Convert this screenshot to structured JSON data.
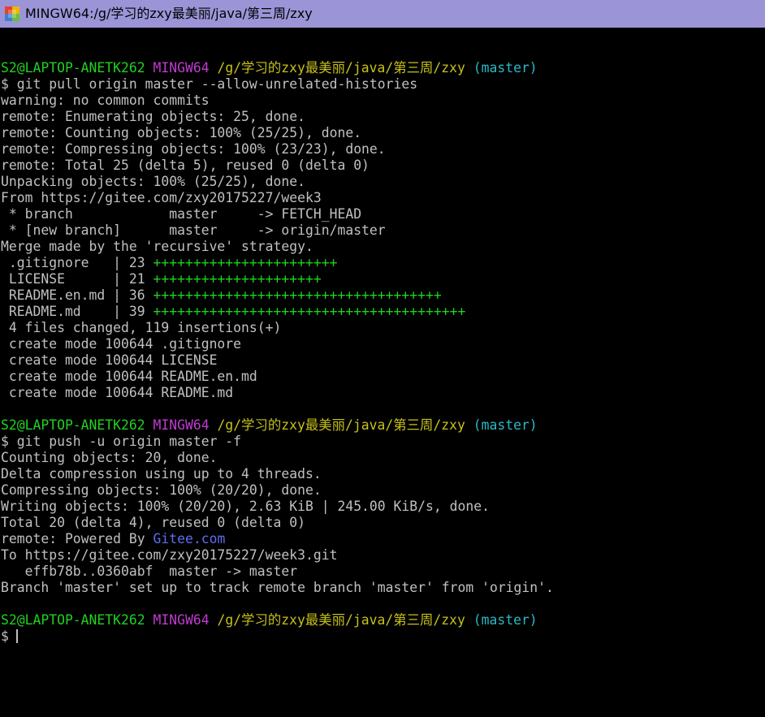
{
  "window": {
    "title": "MINGW64:/g/学习的zxy最美丽/java/第三周/zxy",
    "icon": "git-bash-icon"
  },
  "colors": {
    "default": "#c0c0c0",
    "green": "#1fd31f",
    "magenta": "#c03bd0",
    "yellow": "#c6c01b",
    "cyan": "#2bb9c6",
    "blue": "#5f6cf0",
    "titlebar": "#9b95d8"
  },
  "lines": [
    [],
    [
      {
        "t": "S2@LAPTOP-ANETK262 ",
        "c": "green"
      },
      {
        "t": "MINGW64 ",
        "c": "magenta"
      },
      {
        "t": "/g/学习的zxy最美丽/java/第三周/zxy ",
        "c": "yellow"
      },
      {
        "t": "(master)",
        "c": "cyan"
      }
    ],
    [
      {
        "t": "$ git pull origin master --allow-unrelated-histories"
      }
    ],
    [
      {
        "t": "warning: no common commits"
      }
    ],
    [
      {
        "t": "remote: Enumerating objects: 25, done."
      }
    ],
    [
      {
        "t": "remote: Counting objects: 100% (25/25), done."
      }
    ],
    [
      {
        "t": "remote: Compressing objects: 100% (23/23), done."
      }
    ],
    [
      {
        "t": "remote: Total 25 (delta 5), reused 0 (delta 0)"
      }
    ],
    [
      {
        "t": "Unpacking objects: 100% (25/25), done."
      }
    ],
    [
      {
        "t": "From https://gitee.com/zxy20175227/week3"
      }
    ],
    [
      {
        "t": " * branch            master     -> FETCH_HEAD"
      }
    ],
    [
      {
        "t": " * [new branch]      master     -> origin/master"
      }
    ],
    [
      {
        "t": "Merge made by the 'recursive' strategy."
      }
    ],
    [
      {
        "t": " .gitignore   | 23 "
      },
      {
        "t": "+++++++++++++++++++++++",
        "c": "green"
      }
    ],
    [
      {
        "t": " LICENSE      | 21 "
      },
      {
        "t": "+++++++++++++++++++++",
        "c": "green"
      }
    ],
    [
      {
        "t": " README.en.md | 36 "
      },
      {
        "t": "++++++++++++++++++++++++++++++++++++",
        "c": "green"
      }
    ],
    [
      {
        "t": " README.md    | 39 "
      },
      {
        "t": "+++++++++++++++++++++++++++++++++++++++",
        "c": "green"
      }
    ],
    [
      {
        "t": " 4 files changed, 119 insertions(+)"
      }
    ],
    [
      {
        "t": " create mode 100644 .gitignore"
      }
    ],
    [
      {
        "t": " create mode 100644 LICENSE"
      }
    ],
    [
      {
        "t": " create mode 100644 README.en.md"
      }
    ],
    [
      {
        "t": " create mode 100644 README.md"
      }
    ],
    [],
    [
      {
        "t": "S2@LAPTOP-ANETK262 ",
        "c": "green"
      },
      {
        "t": "MINGW64 ",
        "c": "magenta"
      },
      {
        "t": "/g/学习的zxy最美丽/java/第三周/zxy ",
        "c": "yellow"
      },
      {
        "t": "(master)",
        "c": "cyan"
      }
    ],
    [
      {
        "t": "$ git push -u origin master -f"
      }
    ],
    [
      {
        "t": "Counting objects: 20, done."
      }
    ],
    [
      {
        "t": "Delta compression using up to 4 threads."
      }
    ],
    [
      {
        "t": "Compressing objects: 100% (20/20), done."
      }
    ],
    [
      {
        "t": "Writing objects: 100% (20/20), 2.63 KiB | 245.00 KiB/s, done."
      }
    ],
    [
      {
        "t": "Total 20 (delta 4), reused 0 (delta 0)"
      }
    ],
    [
      {
        "t": "remote: Powered By "
      },
      {
        "t": "Gitee.com",
        "c": "blue"
      }
    ],
    [
      {
        "t": "To https://gitee.com/zxy20175227/week3.git"
      }
    ],
    [
      {
        "t": "   effb78b..0360abf  master -> master"
      }
    ],
    [
      {
        "t": "Branch 'master' set up to track remote branch 'master' from 'origin'."
      }
    ],
    [],
    [
      {
        "t": "S2@LAPTOP-ANETK262 ",
        "c": "green"
      },
      {
        "t": "MINGW64 ",
        "c": "magenta"
      },
      {
        "t": "/g/学习的zxy最美丽/java/第三周/zxy ",
        "c": "yellow"
      },
      {
        "t": "(master)",
        "c": "cyan"
      }
    ],
    [
      {
        "t": "$"
      }
    ]
  ]
}
